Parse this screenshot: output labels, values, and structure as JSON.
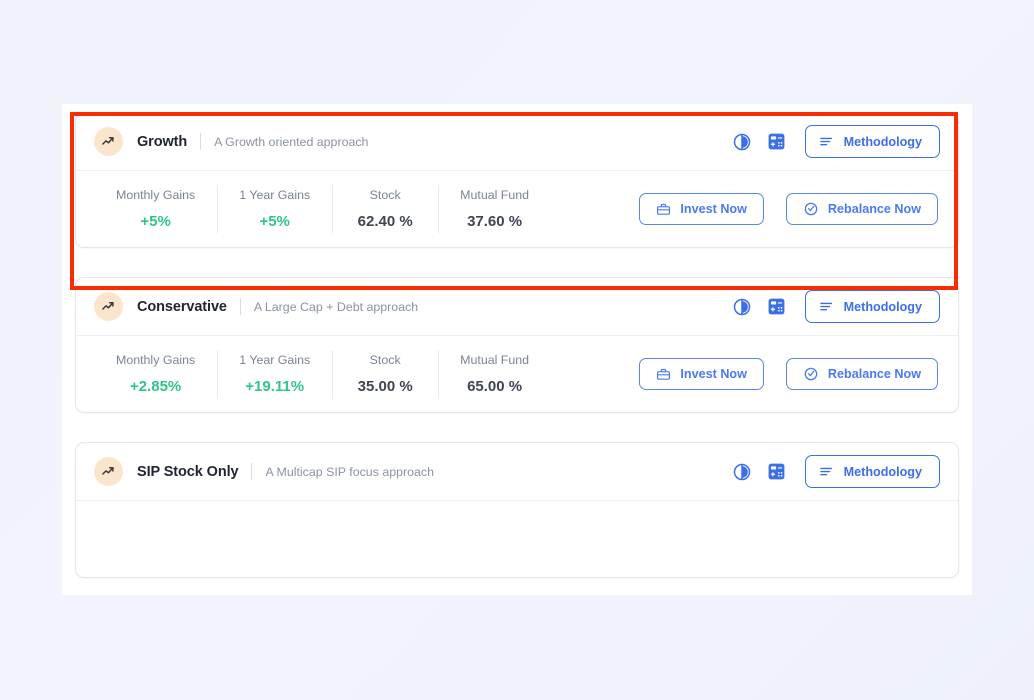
{
  "theme": {
    "accent_blue": "#3b6fe8",
    "gain_green": "#2dc58a",
    "value_gray": "#3f4553",
    "label_gray": "#7b8493",
    "avatar_bg": "#fce5cd",
    "annotation_red": "#f92c02",
    "page_bg": "#f1f3fd"
  },
  "header_actions": {
    "pie_chart_icon": "pie-chart-icon",
    "calculator_icon": "calculator-icon",
    "methodology_label": "Methodology",
    "methodology_icon": "lines-icon"
  },
  "body_actions": {
    "invest_label": "Invest Now",
    "invest_icon": "briefcase-icon",
    "rebalance_label": "Rebalance Now",
    "rebalance_icon": "refresh-check-icon"
  },
  "stat_labels": {
    "monthly_gains": "Monthly Gains",
    "one_year_gains": "1 Year Gains",
    "stock": "Stock",
    "mutual_fund": "Mutual Fund"
  },
  "cards": [
    {
      "title": "Growth",
      "subtitle": "A Growth oriented approach",
      "avatar_icon": "trending-up-icon",
      "stats": {
        "monthly_gains": "+5%",
        "one_year_gains": "+5%",
        "stock": "62.40 %",
        "mutual_fund": "37.60 %"
      },
      "highlighted": true
    },
    {
      "title": "Conservative",
      "subtitle": "A Large Cap + Debt approach",
      "avatar_icon": "trending-up-icon",
      "stats": {
        "monthly_gains": "+2.85%",
        "one_year_gains": "+19.11%",
        "stock": "35.00 %",
        "mutual_fund": "65.00 %"
      },
      "highlighted": false
    },
    {
      "title": "SIP Stock Only",
      "subtitle": "A Multicap SIP focus approach",
      "avatar_icon": "trending-up-icon",
      "stats": {
        "monthly_gains": "",
        "one_year_gains": "",
        "stock": "",
        "mutual_fund": ""
      },
      "highlighted": false
    }
  ]
}
